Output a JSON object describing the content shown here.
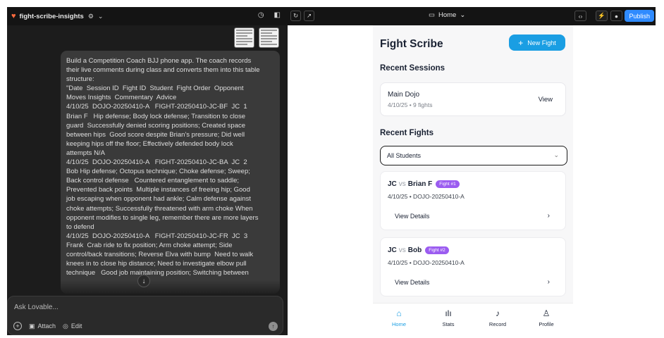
{
  "editor": {
    "project_name": "fight-scribe-insights",
    "composer_placeholder": "Ask Lovable...",
    "attach_label": "Attach",
    "edit_label": "Edit",
    "message_text": "Build a Competition Coach BJJ phone app. The coach records\ntheir live comments during class and converts them into this table\nstructure:\n\"Date  Session ID  Fight ID  Student  Fight Order  Opponent\nMoves Insights  Commentary  Advice\n4/10/25  DOJO-20250410-A   FIGHT-20250410-JC-BF  JC  1\nBrian F   Hip defense; Body lock defense; Transition to close\nguard  Successfully denied scoring positions; Created space\nbetween hips  Good score despite Brian's pressure; Did well\nkeeping hips off the floor; Effectively defended body lock\nattempts N/A\n4/10/25  DOJO-20250410-A   FIGHT-20250410-JC-BA  JC  2\nBob Hip defense; Octopus technique; Choke defense; Sweep;\nBack control defense   Countered entanglement to saddle;\nPrevented back points  Multiple instances of freeing hip; Good\njob escaping when opponent had ankle; Calm defense against\nchoke attempts; Successfully threatened with arm choke When\nopponent modifies to single leg, remember there are more layers\nto defend\n4/10/25  DOJO-20250410-A   FIGHT-20250410-JC-FR  JC  3\nFrank  Crab ride to fix position; Arm choke attempt; Side\ncontrol/back transitions; Reverse Elva with bump  Need to walk\nknees in to close hip distance; Need to investigate elbow pull\ntechnique   Good job maintaining position; Switching between"
  },
  "toolbar": {
    "route_label": "Home",
    "publish_label": "Publish"
  },
  "app": {
    "title": "Fight Scribe",
    "new_fight_label": "New Fight",
    "recent_sessions_title": "Recent Sessions",
    "session": {
      "name": "Main Dojo",
      "meta": "4/10/25 • 9 fights",
      "view_label": "View"
    },
    "recent_fights_title": "Recent Fights",
    "student_filter": "All Students",
    "fights": [
      {
        "student": "JC",
        "vs": "vs",
        "opponent": "Brian F",
        "badge": "Fight #1",
        "meta": "4/10/25 • DOJO-20250410-A",
        "details_label": "View Details"
      },
      {
        "student": "JC",
        "vs": "vs",
        "opponent": "Bob",
        "badge": "Fight #2",
        "meta": "4/10/25 • DOJO-20250410-A",
        "details_label": "View Details"
      }
    ],
    "nav": [
      {
        "label": "Home",
        "icon": "home-icon"
      },
      {
        "label": "Stats",
        "icon": "stats-icon"
      },
      {
        "label": "Record",
        "icon": "microphone-icon"
      },
      {
        "label": "Profile",
        "icon": "profile-icon"
      }
    ]
  },
  "colors": {
    "accent": "#1a9ee3",
    "badge": "#9b5cf0",
    "publish": "#2f8bff",
    "editor_bg": "#1c1c1c"
  }
}
